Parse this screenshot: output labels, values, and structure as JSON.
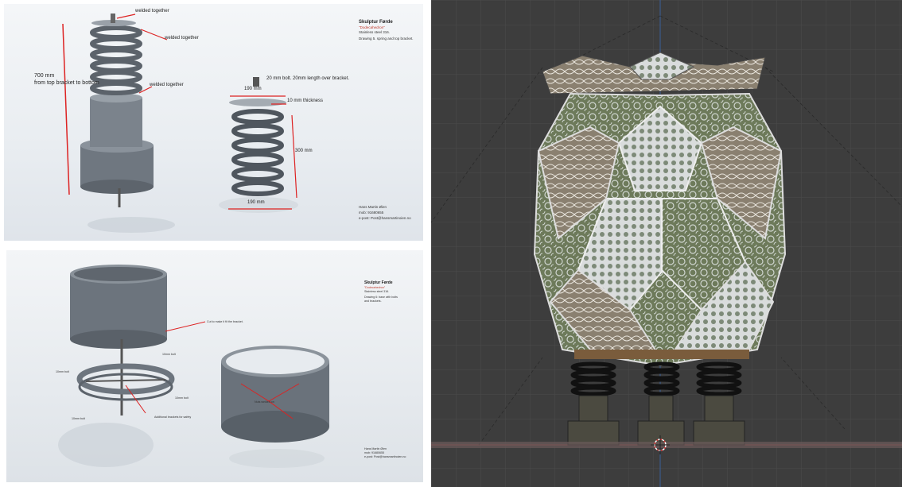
{
  "top_sheet": {
    "title": "Skulptur Førde",
    "subtitle": "\"Dodecahedron\"",
    "material": "Stainless steel 316.",
    "drawing": "Drawing 5. spring and top bracket.",
    "labels": {
      "welded1": "welded together",
      "welded2": "welded together",
      "welded3": "welded together",
      "height": "700 mm",
      "height_note": "from top bracket to bottom",
      "bolt": "20 mm bolt.  20mm length over bracket.",
      "top_dim": "190 mm",
      "thickness": "10 mm thickness",
      "spring_height": "300 mm",
      "bottom_dim": "190 mm"
    },
    "contact": {
      "name": "Hans Martin Øien",
      "mob": "mob: 91680655",
      "email": "e-post: Post@hansmartinoien.no"
    }
  },
  "bottom_sheet": {
    "title": "Skulptur Førde",
    "subtitle": "\"Dodecahedron\"",
    "material": "Stainless steel 316.",
    "drawing": "Drawing 6: base with bolts",
    "drawing2": "and brackets.",
    "labels": {
      "cut": "Cut to make it fit the bracket.",
      "bolt_a": "10mm bolt",
      "bolt_b": "10mm bolt",
      "bolt_c": "10mm bolt",
      "bolt_d": "10mm bolt",
      "brackets": "Additional brackets for safety",
      "nuts": "Nuts welded on"
    },
    "contact": {
      "name": "Hans Martin Øien",
      "mob": "mob: 91680655",
      "email": "e-post: Post@hansmartinoien.no"
    }
  },
  "viewport": {
    "background": "#3d3d3d"
  }
}
